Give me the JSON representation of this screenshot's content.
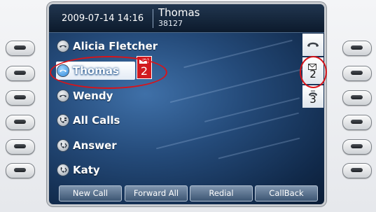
{
  "header": {
    "datetime": "2009-07-14 14:16",
    "line_name": "Thomas",
    "line_number": "38127"
  },
  "lines": [
    {
      "label": "Alicia Fletcher",
      "icon": "handset-icon",
      "selected": false
    },
    {
      "label": "Thomas",
      "icon": "handset-icon",
      "selected": true
    },
    {
      "label": "Wendy",
      "icon": "handset-icon",
      "selected": false
    },
    {
      "label": "All Calls",
      "icon": "all-calls-icon",
      "selected": false
    },
    {
      "label": "Answer",
      "icon": "answer-icon",
      "selected": false
    },
    {
      "label": "Katy",
      "icon": "answer-icon",
      "selected": false
    }
  ],
  "voicemail_badge": {
    "icon": "voicemail-envelope-icon",
    "count": "2",
    "color": "#d11a1f"
  },
  "right_column": {
    "items": [
      {
        "icon": "handset-icon",
        "count": ""
      },
      {
        "icon": "voicemail-envelope-icon",
        "count": "2"
      },
      {
        "icon": "call-ringing-icon",
        "count": "3"
      }
    ]
  },
  "softkeys": [
    "New Call",
    "Forward All",
    "Redial",
    "CallBack"
  ],
  "highlight_color": "#d7141a"
}
